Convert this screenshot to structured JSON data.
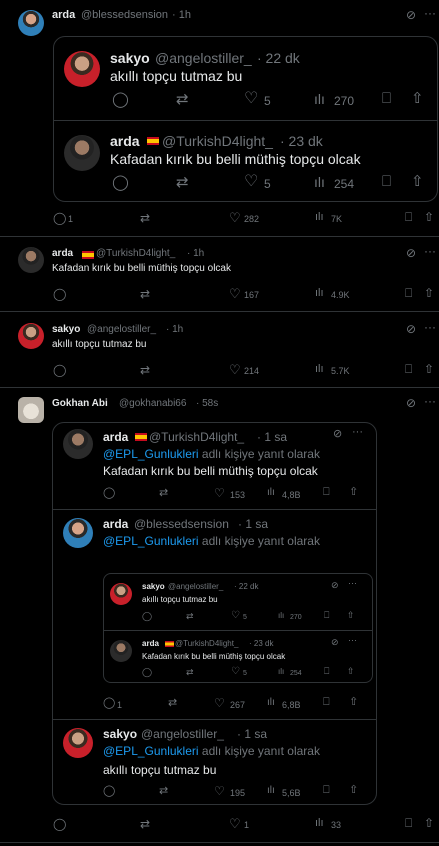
{
  "post1": {
    "name": "arda",
    "handle": "@blessedsension",
    "time": "· 1h",
    "quote1": {
      "name": "sakyo",
      "handle": "@angelostiller_",
      "time": "· 22 dk",
      "text": "akıllı topçu tutmaz bu",
      "likes": "5",
      "views": "270"
    },
    "quote2": {
      "name": "arda",
      "handle": "@TurkishD4light_",
      "time": "· 23 dk",
      "text": "Kafadan kırık bu belli müthiş topçu olcak",
      "likes": "5",
      "views": "254"
    },
    "replies": "1",
    "likes": "282",
    "views": "7K"
  },
  "post2": {
    "name": "arda",
    "handle": "@TurkishD4light_",
    "time": "· 1h",
    "text": "Kafadan kırık bu belli müthiş topçu olcak",
    "likes": "167",
    "views": "4.9K"
  },
  "post3": {
    "name": "sakyo",
    "handle": "@angelostiller_",
    "time": "· 1h",
    "text": "akıllı topçu tutmaz bu",
    "likes": "214",
    "views": "5.7K"
  },
  "post4": {
    "name": "Gokhan Abi",
    "handle": "@gokhanabi66",
    "time": "· 58s",
    "replying_prefix": "@EPL_Gunlukleri",
    "replying_suffix": " adlı kişiye yanıt olarak",
    "a": {
      "name": "arda",
      "handle": "@TurkishD4light_",
      "time": "· 1 sa",
      "text": "Kafadan kırık bu belli müthiş topçu olcak",
      "likes": "153",
      "views": "4,8B"
    },
    "b": {
      "name": "arda",
      "handle": "@blessedsension",
      "time": "· 1 sa",
      "sub1": {
        "name": "sakyo",
        "handle": "@angelostiller_",
        "time": "· 22 dk",
        "text": "akıllı topçu tutmaz bu",
        "likes": "5",
        "views": "270"
      },
      "sub2": {
        "name": "arda",
        "handle": "@TurkishD4light_",
        "time": "· 23 dk",
        "text": "Kafadan kırık bu belli müthiş topçu olcak",
        "likes": "5",
        "views": "254"
      },
      "replies": "1",
      "likes": "267",
      "views": "6,8B"
    },
    "c": {
      "name": "sakyo",
      "handle": "@angelostiller_",
      "time": "· 1 sa",
      "text": "akıllı topçu tutmaz bu",
      "likes": "195",
      "views": "5,6B"
    },
    "likes": "1",
    "views": "33"
  }
}
